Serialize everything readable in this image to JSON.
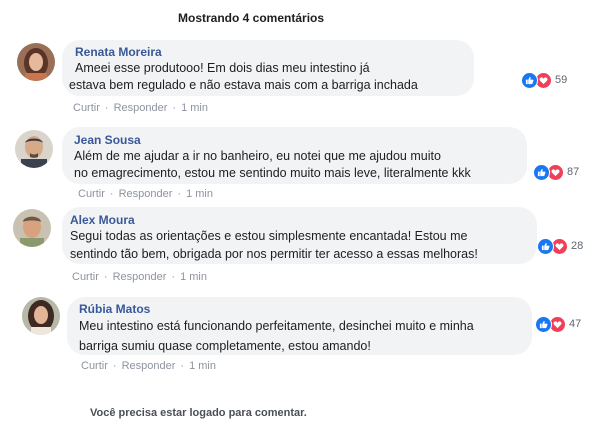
{
  "header": {
    "title": "Mostrando 4 comentários"
  },
  "comments": [
    {
      "author": "Renata Moreira",
      "lines": [
        "Ameei esse produtooo! Em dois dias meu intestino já",
        "estava bem regulado e não estava mais com a barriga inchada"
      ],
      "reactions": {
        "count": "59",
        "icons": [
          "like-icon",
          "heart-icon"
        ]
      },
      "actions": {
        "like": "Curtir",
        "reply": "Responder",
        "time": "1 min"
      }
    },
    {
      "author": "Jean Sousa",
      "lines": [
        "Além de me ajudar a ir no banheiro, eu notei que me ajudou muito",
        "no emagrecimento, estou me sentindo muito mais leve, literalmente kkk"
      ],
      "reactions": {
        "count": "87",
        "icons": [
          "like-icon",
          "heart-icon"
        ]
      },
      "actions": {
        "like": "Curtir",
        "reply": "Responder",
        "time": "1 min"
      }
    },
    {
      "author": "Alex Moura",
      "lines": [
        "Segui todas as orientações e estou simplesmente encantada! Estou me",
        "sentindo tão bem, obrigada por nos permitir ter acesso a essas melhoras!"
      ],
      "reactions": {
        "count": "28",
        "icons": [
          "like-icon",
          "heart-icon"
        ]
      },
      "actions": {
        "like": "Curtir",
        "reply": "Responder",
        "time": "1 min"
      }
    },
    {
      "author": "Rúbia Matos",
      "lines": [
        "Meu intestino está funcionando perfeitamente, desinchei muito e minha",
        "barriga sumiu quase completamente, estou amando!"
      ],
      "reactions": {
        "count": "47",
        "icons": [
          "like-icon",
          "heart-icon"
        ]
      },
      "actions": {
        "like": "Curtir",
        "reply": "Responder",
        "time": "1 min"
      }
    }
  ],
  "footer": {
    "message": "Você precisa estar logado para comentar."
  },
  "colors": {
    "author": "#385898",
    "like": "#1877f2",
    "love": "#f33e58",
    "bubble": "#f2f3f5"
  }
}
